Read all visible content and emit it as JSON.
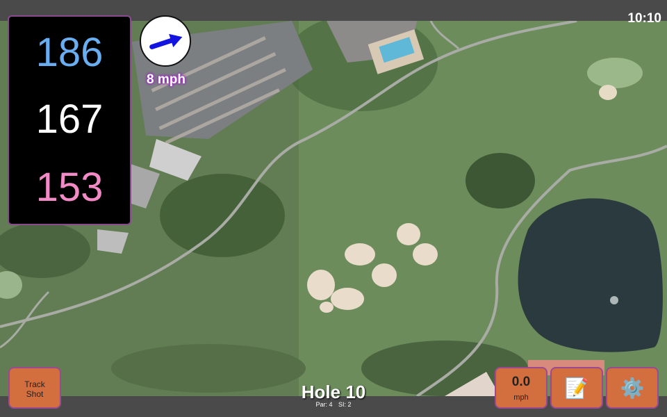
{
  "status": {
    "time": "10:10"
  },
  "distances": {
    "back": "186",
    "middle": "167",
    "front": "153"
  },
  "wind": {
    "speed_label": "8 mph",
    "direction_icon": "wind-arrow-icon"
  },
  "hole": {
    "title": "Hole 10",
    "par": "Par: 4",
    "si": "SI: 2"
  },
  "buttons": {
    "track_shot": "Track Shot",
    "wind_value": "0.0",
    "wind_unit": "mph",
    "notes_icon": "📝",
    "settings_icon": "⚙️"
  },
  "colors": {
    "back": "#6aaef2",
    "middle": "#ffffff",
    "front": "#f28ac6",
    "button": "#d36f3f",
    "button_border": "#9b4a8f",
    "wind_arrow": "#1414e0"
  }
}
